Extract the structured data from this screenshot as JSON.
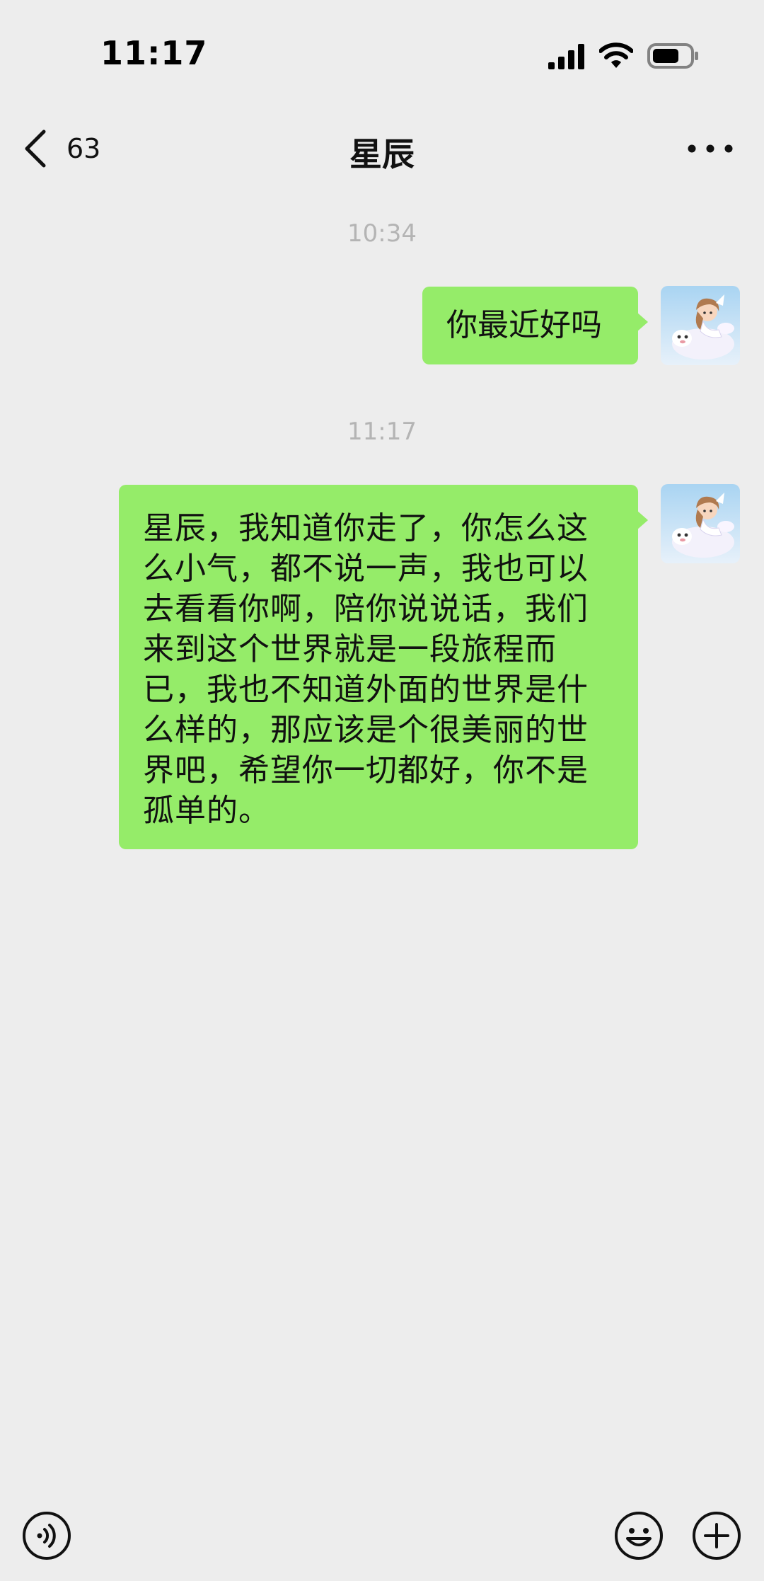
{
  "status_bar": {
    "time": "11:17",
    "signal_icon": "cellular-signal-icon",
    "wifi_icon": "wifi-icon",
    "battery_icon": "battery-icon"
  },
  "nav": {
    "back_icon": "chevron-left-icon",
    "unread_count": "63",
    "title": "星辰",
    "more_icon": "more-horizontal-icon"
  },
  "chat": {
    "messages": [
      {
        "timestamp": "10:34",
        "sender": "self",
        "lines": [
          "你最近好吗"
        ]
      },
      {
        "timestamp": "11:17",
        "sender": "self",
        "lines": [
          "星辰，我知道你走了，你怎么这",
          "么小气，都不说一声，我也可以",
          "去看看你啊，陪你说说话，我们",
          "来到这个世界就是一段旅程而",
          "已，我也不知道外面的世界是什",
          "么样的，那应该是个很美丽的世",
          "界吧，希望你一切都好，你不是",
          "孤单的。"
        ]
      }
    ],
    "bubble_color": "#95ec69",
    "background_color": "#ededed"
  },
  "input_bar": {
    "voice_icon": "voice-input-icon",
    "emoji_icon": "emoji-icon",
    "plus_icon": "plus-circle-icon"
  }
}
